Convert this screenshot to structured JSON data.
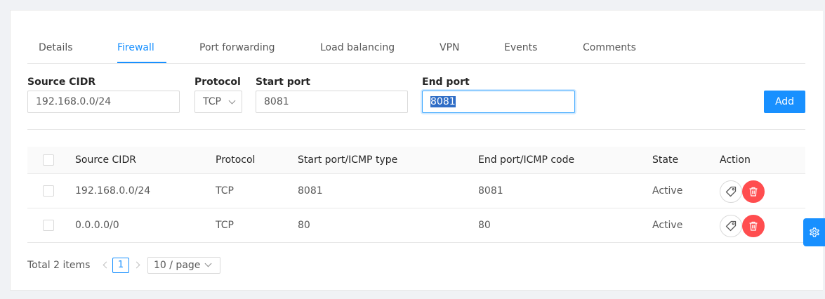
{
  "tabs": [
    {
      "label": "Details",
      "active": false
    },
    {
      "label": "Firewall",
      "active": true
    },
    {
      "label": "Port forwarding",
      "active": false
    },
    {
      "label": "Load balancing",
      "active": false
    },
    {
      "label": "VPN",
      "active": false
    },
    {
      "label": "Events",
      "active": false
    },
    {
      "label": "Comments",
      "active": false
    }
  ],
  "form": {
    "source_cidr": {
      "label": "Source CIDR",
      "value": "192.168.0.0/24"
    },
    "protocol": {
      "label": "Protocol",
      "value": "TCP"
    },
    "start_port": {
      "label": "Start port",
      "value": "8081"
    },
    "end_port": {
      "label": "End port",
      "value": "8081",
      "selected": true
    },
    "add_label": "Add"
  },
  "table": {
    "columns": [
      "Source CIDR",
      "Protocol",
      "Start port/ICMP type",
      "End port/ICMP code",
      "State",
      "Action"
    ],
    "rows": [
      {
        "source_cidr": "192.168.0.0/24",
        "protocol": "TCP",
        "start_port": "8081",
        "end_port": "8081",
        "state": "Active"
      },
      {
        "source_cidr": "0.0.0.0/0",
        "protocol": "TCP",
        "start_port": "80",
        "end_port": "80",
        "state": "Active"
      }
    ]
  },
  "pagination": {
    "total_text": "Total 2 items",
    "current_page": "1",
    "page_size": "10 / page"
  },
  "icons": {
    "tag": "tag-icon",
    "delete": "delete-icon",
    "settings": "gear-icon"
  },
  "colors": {
    "primary": "#1890ff",
    "danger": "#ff4d4f"
  }
}
